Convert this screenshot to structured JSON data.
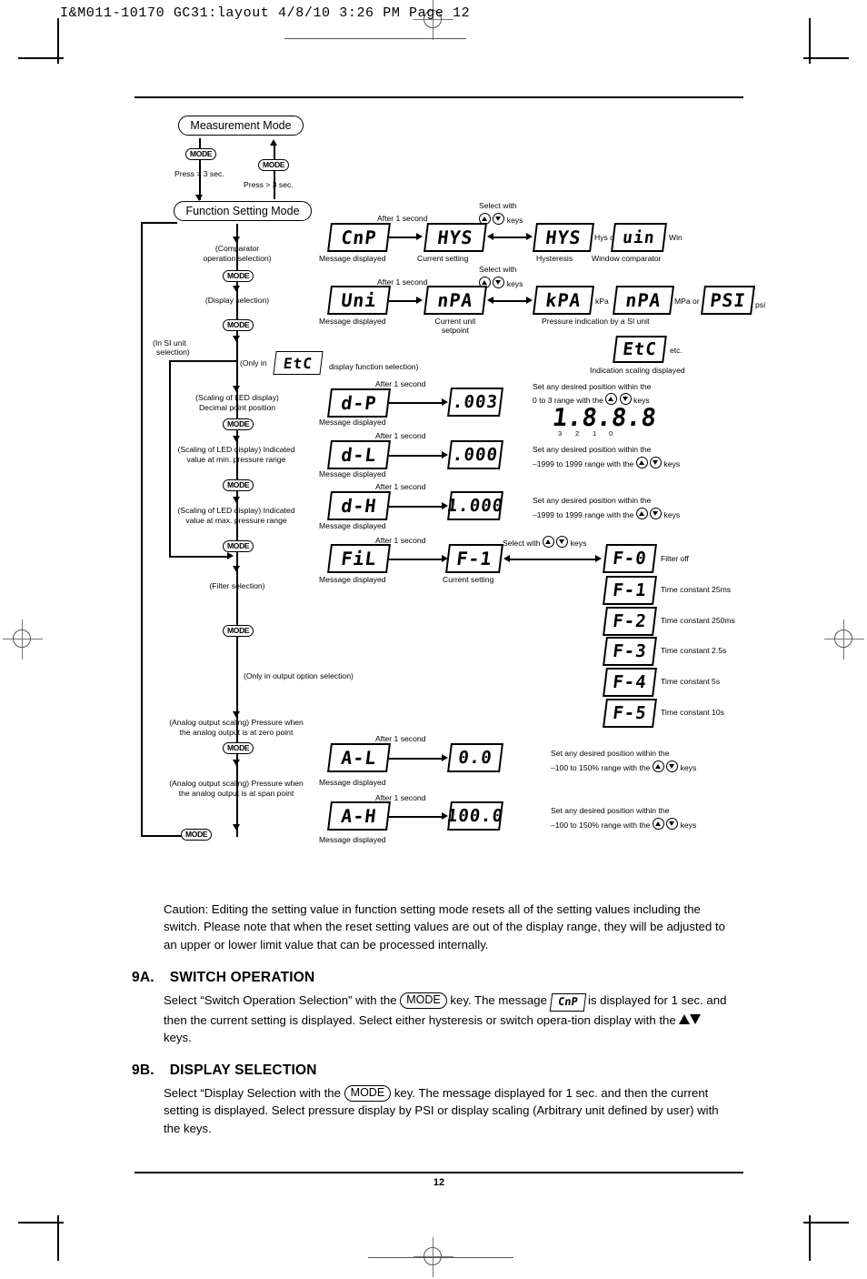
{
  "print_header": "I&M011-10170 GC31:layout   4/8/10   3:26 PM   Page 12",
  "page_number": "12",
  "flow": {
    "measurement_mode": "Measurement Mode",
    "function_setting_mode": "Function Setting Mode",
    "mode_key": "MODE",
    "press_note_1": "Press > 3 sec.",
    "press_note_2": "Press > 3 sec.",
    "steps": [
      {
        "line1": "(Comparator",
        "line2": "operation selection)"
      },
      {
        "line1": "(Display selection)",
        "line2": ""
      },
      {
        "line1": "(Scaling of LED display)",
        "line2": "Decimal point position"
      },
      {
        "line1": "(Scaling of LED display) Indicated",
        "line2": "value at min. pressure range"
      },
      {
        "line1": "(Scaling of LED display) Indicated",
        "line2": "value at max. pressure range"
      },
      {
        "line1": "(Filter selection)",
        "line2": ""
      },
      {
        "line1": "(Analog output scaling) Pressure when",
        "line2": "the analog output is at zero point"
      },
      {
        "line1": "(Analog output scaling) Pressure when",
        "line2": "the analog output is at span point"
      }
    ],
    "si_unit_note_l1": "(In SI unit",
    "si_unit_note_l2": "selection)",
    "only_in_prefix": "(Only in",
    "only_in_suffix": "display function selection)",
    "only_in_led": "EtC",
    "only_output_option": "(Only in output option selection)"
  },
  "labels": {
    "after_1_second": "After 1 second",
    "select_with": "Select with",
    "keys": "keys",
    "message_displayed": "Message displayed",
    "current_setting": "Current setting",
    "current_unit_setpoint_l1": "Current unit",
    "current_unit_setpoint_l2": "setpoint"
  },
  "rows": {
    "comparator": {
      "message_led": "CnP",
      "current_led": "HYS",
      "option_a_led": "HYS",
      "option_a_label": "Hysteresis",
      "option_a_suffix": "Hys or",
      "option_b_led": "uin",
      "option_b_label": "Window comparator",
      "option_b_suffix": "Win"
    },
    "unit": {
      "message_led": "Uni",
      "current_led": "nPA",
      "si_caption": "Pressure indication by a SI unit",
      "options": [
        {
          "led": "kPA",
          "suffix": "kPa"
        },
        {
          "led": "nPA",
          "suffix": "MPa or"
        },
        {
          "led": "PSI",
          "suffix": "psi"
        }
      ],
      "etc_led": "EtC",
      "etc_suffix": "etc.",
      "etc_caption": "Indication scaling displayed"
    },
    "decimal_point": {
      "message_led": "d-P",
      "value_led": ".003",
      "note_l1": "Set any desired position within the",
      "note_l2_pre": "0 to 3 range with the",
      "note_l2_post": "keys",
      "figure": "1.8.8.8",
      "figure_positions": [
        "3",
        "2",
        "1",
        "0"
      ]
    },
    "display_low": {
      "message_led": "d-L",
      "value_led": ".000",
      "note_l1": "Set any desired position within the",
      "note_l2_pre": "–1999 to 1999 range with the",
      "note_l2_post": "keys"
    },
    "display_high": {
      "message_led": "d-H",
      "value_led": "1.000",
      "note_l1": "Set any desired position within the",
      "note_l2_pre": "–1999 to 1999 range with the",
      "note_l2_post": "keys"
    },
    "filter": {
      "message_led": "FiL",
      "current_led": "F-1",
      "options": [
        {
          "led": "F-0",
          "label": "Filter off"
        },
        {
          "led": "F-1",
          "label": "Time constant 25ms"
        },
        {
          "led": "F-2",
          "label": "Time constant 250ms"
        },
        {
          "led": "F-3",
          "label": "Time constant 2.5s"
        },
        {
          "led": "F-4",
          "label": "Time constant 5s"
        },
        {
          "led": "F-5",
          "label": "Time constant 10s"
        }
      ]
    },
    "analog_low": {
      "message_led": "A-L",
      "value_led": "0.0",
      "note_l1": "Set any desired position within the",
      "note_l2_pre": "–100 to 150% range with the",
      "note_l2_post": "keys"
    },
    "analog_high": {
      "message_led": "A-H",
      "value_led": "100.0",
      "note_l1": "Set any desired position within the",
      "note_l2_pre": "–100 to 150% range with the",
      "note_l2_post": "keys"
    }
  },
  "caution": "Caution: Editing the setting value in function setting mode resets all of the setting values including the switch.  Please note that when the reset setting values are out of the display range, they will be adjusted to an upper or lower limit value that can be processed internally.",
  "section_9a": {
    "number": "9A.",
    "title": "SWITCH OPERATION",
    "text_1": "Select “Switch Operation Selection” with the",
    "mode_key": "MODE",
    "text_2": "key.  The message",
    "led": "CnP",
    "text_3": "is displayed for 1 sec. and then the current setting is displayed.  Select either hysteresis or switch opera-tion display with the",
    "text_4": "keys."
  },
  "section_9b": {
    "number": "9B.",
    "title": "DISPLAY SELECTION",
    "text_1": "Select “Display Selection with the",
    "mode_key": "MODE",
    "text_2": "key. The message displayed for 1 sec. and then the current setting is displayed. Select pressure display by PSI or display scaling (Arbitrary unit defined by user) with the keys."
  }
}
